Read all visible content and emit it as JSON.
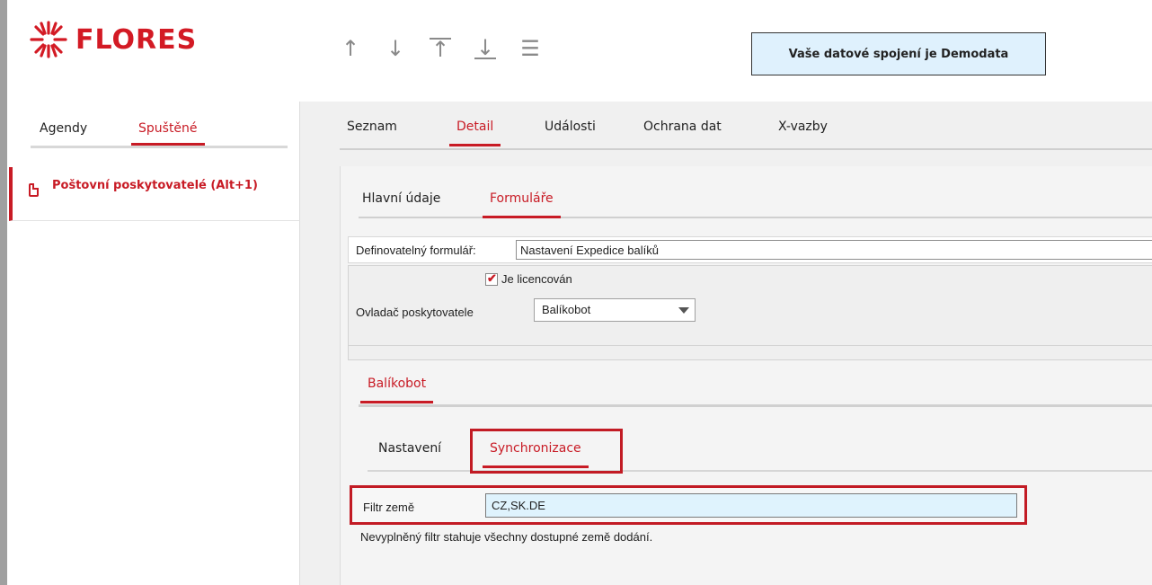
{
  "header": {
    "logo_text": "FLORES",
    "brand_color": "#d31a24",
    "nav_icons": [
      "arrow-up-icon",
      "arrow-down-icon",
      "arrow-top-icon",
      "arrow-bottom-icon",
      "hamburger-menu-icon"
    ],
    "connection_text": "Vaše datové spojení je Demodata"
  },
  "left": {
    "tabs": [
      {
        "label": "Agendy",
        "active": false
      },
      {
        "label": "Spuštěné",
        "active": true
      }
    ],
    "items": [
      {
        "label": "Poštovní poskytovatelé (Alt+1)"
      }
    ]
  },
  "main": {
    "tabs": [
      {
        "label": "Seznam",
        "active": false
      },
      {
        "label": "Detail",
        "active": true
      },
      {
        "label": "Události",
        "active": false
      },
      {
        "label": "Ochrana dat",
        "active": false
      },
      {
        "label": "X-vazby",
        "active": false
      }
    ],
    "sub_tabs": [
      {
        "label": "Hlavní údaje",
        "active": false
      },
      {
        "label": "Formuláře",
        "active": true
      }
    ],
    "form": {
      "label": "Definovatelný formulář:",
      "value": "Nastavení Expedice balíků"
    },
    "options": {
      "checkbox_label": "Je licencován",
      "checked": true,
      "provider_label": "Ovladač poskytovatele",
      "provider_value": "Balíkobot"
    },
    "provider_tabs": [
      {
        "label": "Balíkobot",
        "active": true
      }
    ],
    "inner_tabs": [
      {
        "label": "Nastavení",
        "active": false
      },
      {
        "label": "Synchronizace",
        "active": true
      }
    ],
    "filter": {
      "label": "Filtr země",
      "value": "CZ,SK.DE"
    },
    "hint": "Nevyplněný filtr stahuje všechny dostupné země dodání."
  },
  "colors": {
    "accent": "#c81b25",
    "connection_bg": "#dff1fd",
    "input_highlight_bg": "#dff3fd"
  }
}
